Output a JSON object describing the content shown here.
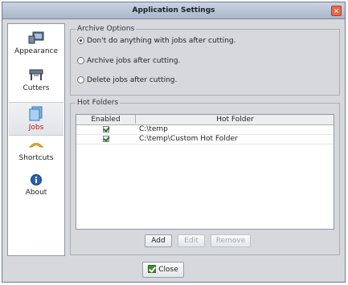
{
  "window": {
    "title": "Application Settings"
  },
  "sidebar": {
    "items": [
      {
        "label": "Appearance",
        "icon": "appearance-icon",
        "selected": false
      },
      {
        "label": "Cutters",
        "icon": "cutter-icon",
        "selected": false
      },
      {
        "label": "Jobs",
        "icon": "jobs-icon",
        "selected": true
      },
      {
        "label": "Shortcuts",
        "icon": "shortcuts-icon",
        "selected": false
      },
      {
        "label": "About",
        "icon": "info-icon",
        "selected": false
      }
    ]
  },
  "archive_options": {
    "legend": "Archive Options",
    "options": [
      {
        "label": "Don't do anything with jobs after cutting.",
        "checked": true
      },
      {
        "label": "Archive jobs after cutting.",
        "checked": false
      },
      {
        "label": "Delete jobs after cutting.",
        "checked": false
      }
    ]
  },
  "hot_folders": {
    "legend": "Hot Folders",
    "columns": [
      "Enabled",
      "Hot Folder"
    ],
    "rows": [
      {
        "enabled": true,
        "path": "C:\\temp"
      },
      {
        "enabled": true,
        "path": "C:\\temp\\Custom Hot Folder"
      }
    ],
    "buttons": {
      "add": "Add",
      "edit": "Edit",
      "remove": "Remove"
    }
  },
  "footer": {
    "close": "Close"
  },
  "colors": {
    "selected_label": "#b01818",
    "window_bg": "#d6d8dc"
  }
}
